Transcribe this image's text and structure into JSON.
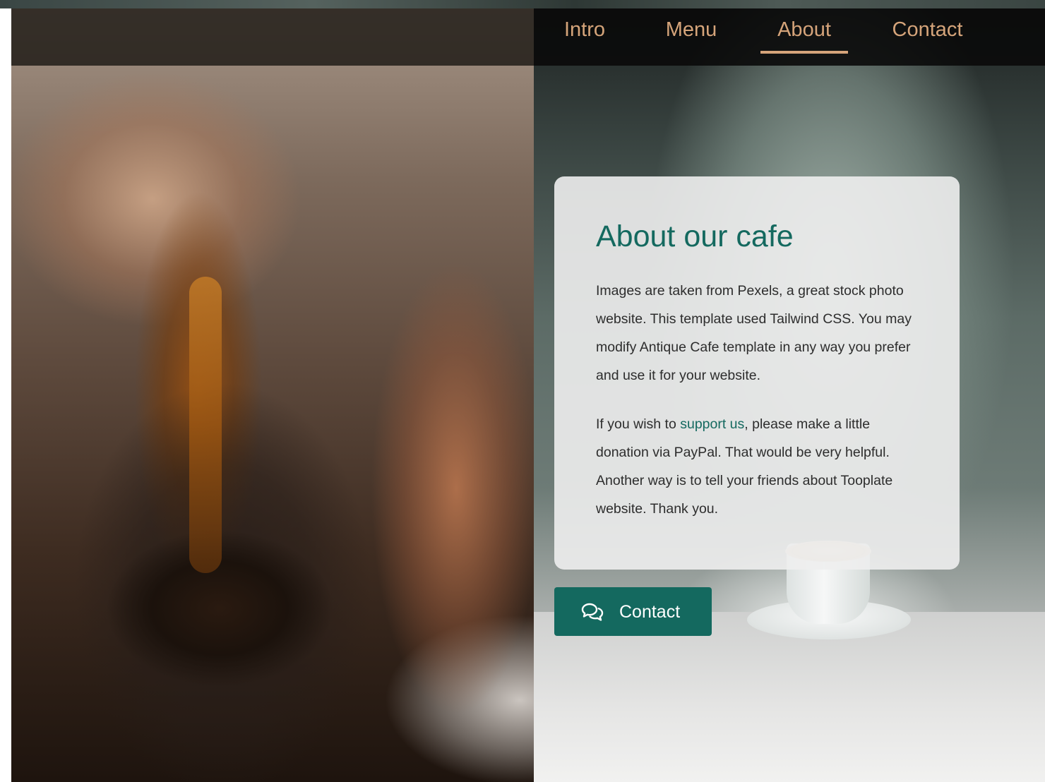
{
  "nav": {
    "items": [
      {
        "label": "Intro"
      },
      {
        "label": "Menu"
      },
      {
        "label": "About"
      },
      {
        "label": "Contact"
      }
    ],
    "active": "About"
  },
  "about": {
    "title": "About our cafe",
    "paragraph1": "Images are taken from Pexels, a great stock photo website. This template used Tailwind CSS. You may modify Antique Cafe template in any way you prefer and use it for your website.",
    "paragraph2_before": "If you wish to ",
    "paragraph2_link": "support us",
    "paragraph2_after": ", please make a little donation via PayPal. That would be very helpful. Another way is to tell your friends about Tooplate website. Thank you."
  },
  "contact_button": {
    "label": "Contact",
    "icon": "chat-bubbles-icon"
  },
  "colors": {
    "accent": "#14695f",
    "nav_text": "#d5a47a",
    "card_background": "#eeeeee"
  },
  "images": {
    "left": "coffee-pouring-photo",
    "right": "barista-serving-cup-photo"
  }
}
